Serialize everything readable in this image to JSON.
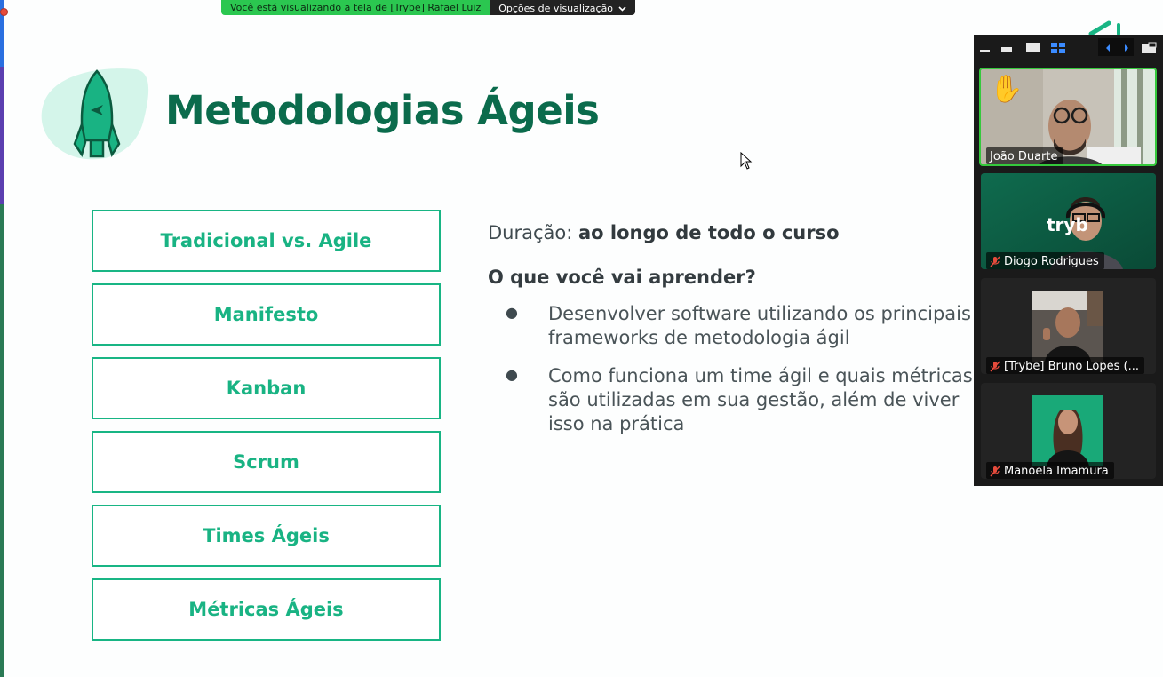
{
  "share_banner": {
    "message": "Você está visualizando a tela de [Trybe] Rafael Luiz",
    "options_label": "Opções de visualização"
  },
  "slide": {
    "title": "Metodologias Ágeis",
    "topics": [
      "Tradicional vs. Agile",
      "Manifesto",
      "Kanban",
      "Scrum",
      "Times Ágeis",
      "Métricas Ágeis"
    ],
    "duration_label": "Duração:",
    "duration_value": "ao longo de todo o curso",
    "question": "O que você vai aprender?",
    "bullets": [
      "Desenvolver software utilizando os principais frameworks de metodologia ágil",
      "Como funciona um time ágil e quais métricas são utilizadas em sua gestão, além de viver isso na prática"
    ]
  },
  "video_panel": {
    "participants": [
      {
        "name": "João Duarte",
        "muted": false,
        "hand_raised": true,
        "active": true
      },
      {
        "name": "Diogo Rodrigues",
        "muted": true,
        "hand_raised": false,
        "active": false
      },
      {
        "name": "[Trybe] Bruno Lopes (...",
        "muted": true,
        "hand_raised": false,
        "active": false
      },
      {
        "name": "Manoela Imamura",
        "muted": true,
        "hand_raised": false,
        "active": false
      }
    ],
    "tile2_logo_text": "tryb"
  },
  "colors": {
    "accent_green": "#18b584",
    "title_green": "#0b6b4c",
    "banner_green": "#2bc750",
    "speaker_border": "#35c93c"
  }
}
